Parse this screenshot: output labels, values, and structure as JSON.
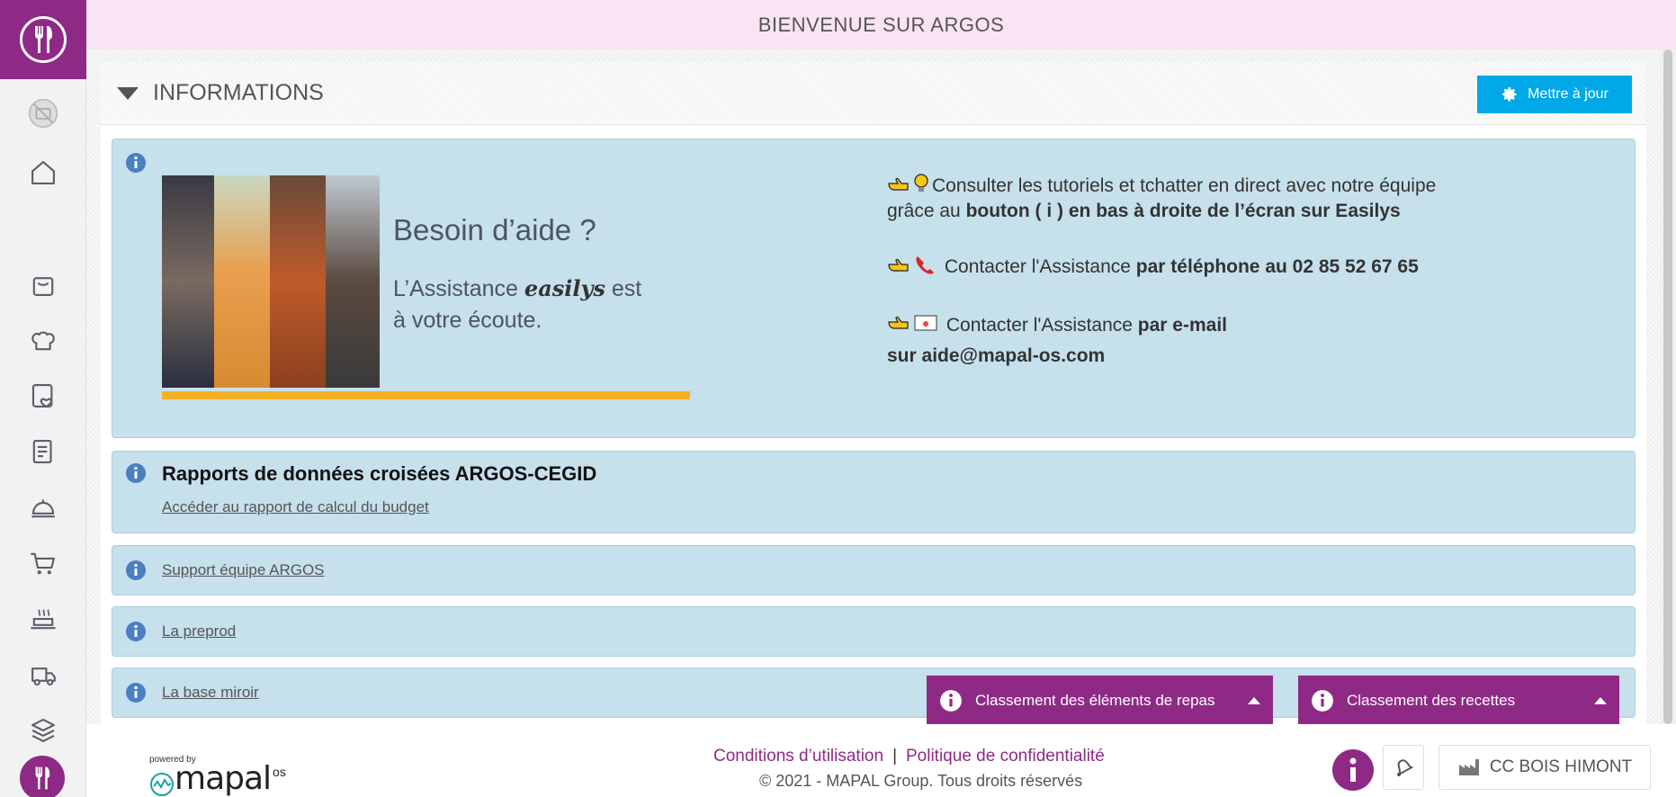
{
  "app": {
    "welcome_title": "BIENVENUE SUR ARGOS"
  },
  "sidebar": {
    "icons": [
      "restaurant-logo-icon",
      "no-photo-icon",
      "home-icon",
      "bag-icon",
      "chef-hat-icon",
      "menu-heart-icon",
      "document-icon",
      "cloche-icon",
      "cart-icon",
      "cooking-pot-icon",
      "delivery-truck-icon",
      "layers-icon",
      "restaurant-logo-icon"
    ]
  },
  "panel": {
    "title": "INFORMATIONS",
    "update_button": "Mettre à jour"
  },
  "help_card": {
    "heading": "Besoin d’aide ?",
    "line1_prefix": "L’Assistance",
    "brand": "easilys",
    "line1_suffix": "est",
    "line2": "à votre écoute.",
    "tutorial_text": "Consulter les tutoriels et tchatter en direct avec notre équipe",
    "tutorial_text2": "grâce au",
    "tutorial_bold": "bouton ( i ) en bas à droite de l’écran sur Easilys",
    "phone_text": "Contacter l'Assistance",
    "phone_bold": "par téléphone au 02 85 52 67 65",
    "email_text": "Contacter l'Assistance",
    "email_bold": "par e-mail",
    "email_address": "sur aide@mapal-os.com"
  },
  "reports_card": {
    "title": "Rapports de données croisées ARGOS-CEGID",
    "link": "Accéder au rapport de calcul du budget"
  },
  "links": {
    "support": "Support équipe ARGOS",
    "preprod": "La preprod",
    "mirror": "La base miroir"
  },
  "floating_tabs": {
    "meal_elements": "Classement des éléments de repas",
    "recipes": "Classement des recettes"
  },
  "footer": {
    "powered_by": "powered by",
    "brand": "mapal",
    "brand_suffix": "os",
    "terms": "Conditions d’utilisation",
    "separator": "|",
    "privacy": "Politique de confidentialité",
    "copyright": "© 2021 - MAPAL Group. Tous droits réservés",
    "site_name": "CC BOIS HIMONT"
  },
  "colors": {
    "brand_purple": "#8e2a86",
    "accent_blue": "#00a8e8",
    "card_blue": "#c6e0ec",
    "highlight_orange": "#f5b023"
  }
}
